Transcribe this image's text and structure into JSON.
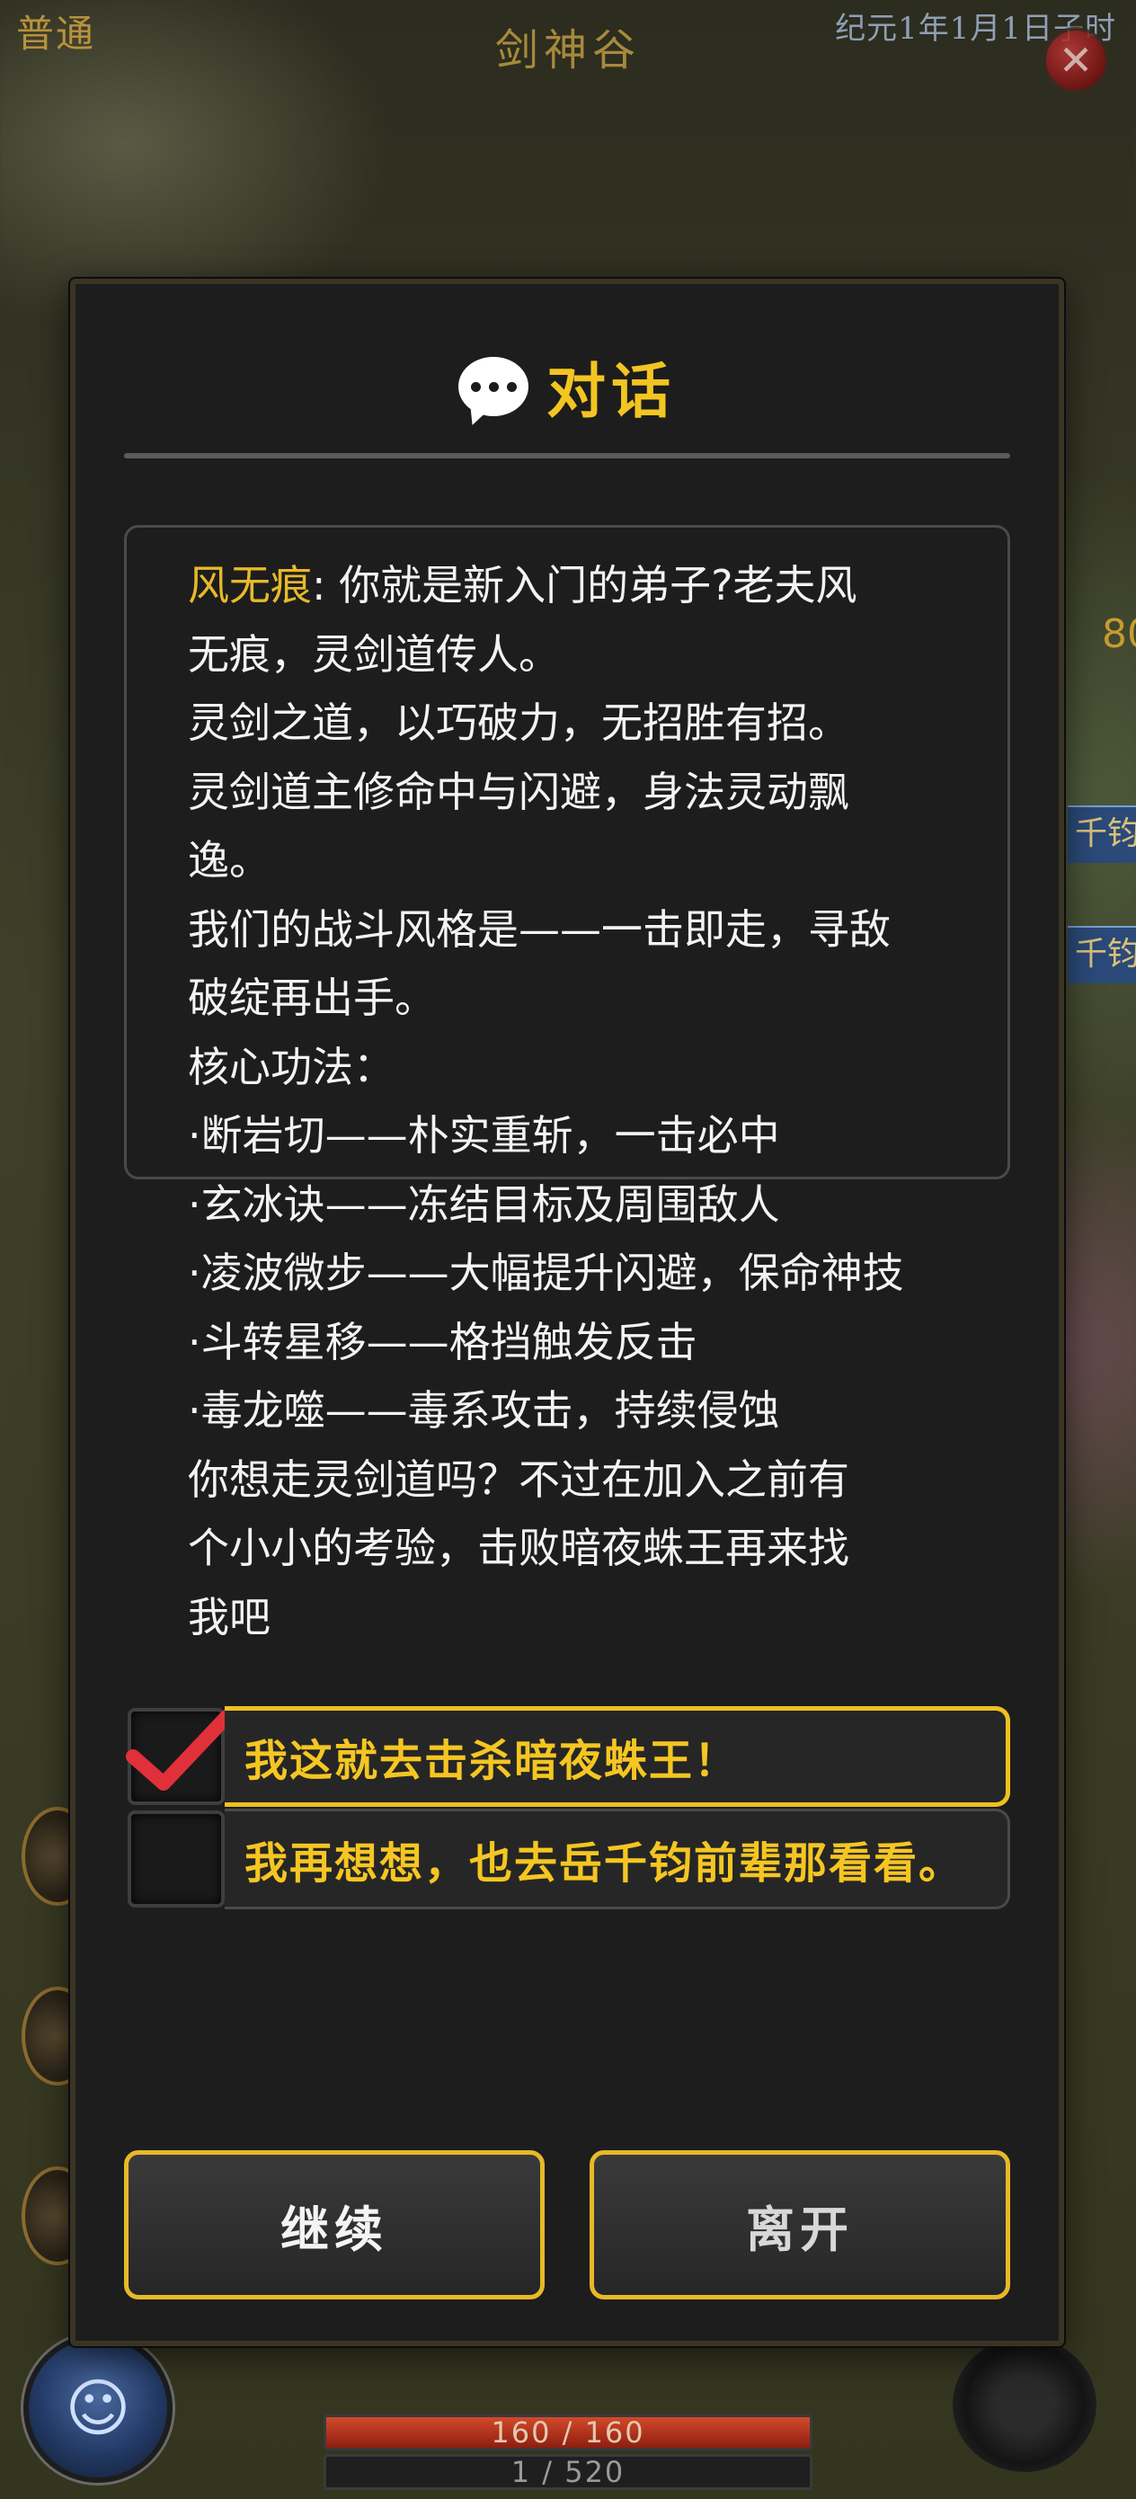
{
  "hud": {
    "mode": "普通",
    "location": "剑神谷",
    "date": "纪元1年1月1日子时",
    "side_number": "80",
    "side_tags": [
      "千钧",
      "千钧"
    ],
    "hp": "160 / 160",
    "exp": "1 / 520",
    "close_icon": "✕"
  },
  "dialog": {
    "title": "对话",
    "speaker": "风无痕",
    "lines": [
      ": 你就是新入门的弟子?老夫风",
      "无痕，灵剑道传人。",
      "灵剑之道，以巧破力，无招胜有招。",
      "灵剑道主修命中与闪避，身法灵动飘",
      "逸。",
      "我们的战斗风格是——一击即走，寻敌",
      "破绽再出手。",
      "核心功法：",
      "·断岩切——朴实重斩，一击必中",
      "·玄冰诀——冻结目标及周围敌人",
      "·凌波微步——大幅提升闪避，保命神技",
      "·斗转星移——格挡触发反击",
      "·毒龙噬——毒系攻击，持续侵蚀",
      "你想走灵剑道吗？不过在加入之前有",
      "个小小的考验，击败暗夜蛛王再来找",
      "我吧"
    ],
    "choices": [
      {
        "label": "我这就去击杀暗夜蛛王！",
        "selected": true
      },
      {
        "label": "我再想想，也去岳千钧前辈那看看。",
        "selected": false
      }
    ],
    "buttons": {
      "continue": "继续",
      "leave": "离开"
    }
  },
  "colors": {
    "accent": "#f2c522",
    "speaker": "#e7b92a",
    "check": "#e0303a"
  }
}
